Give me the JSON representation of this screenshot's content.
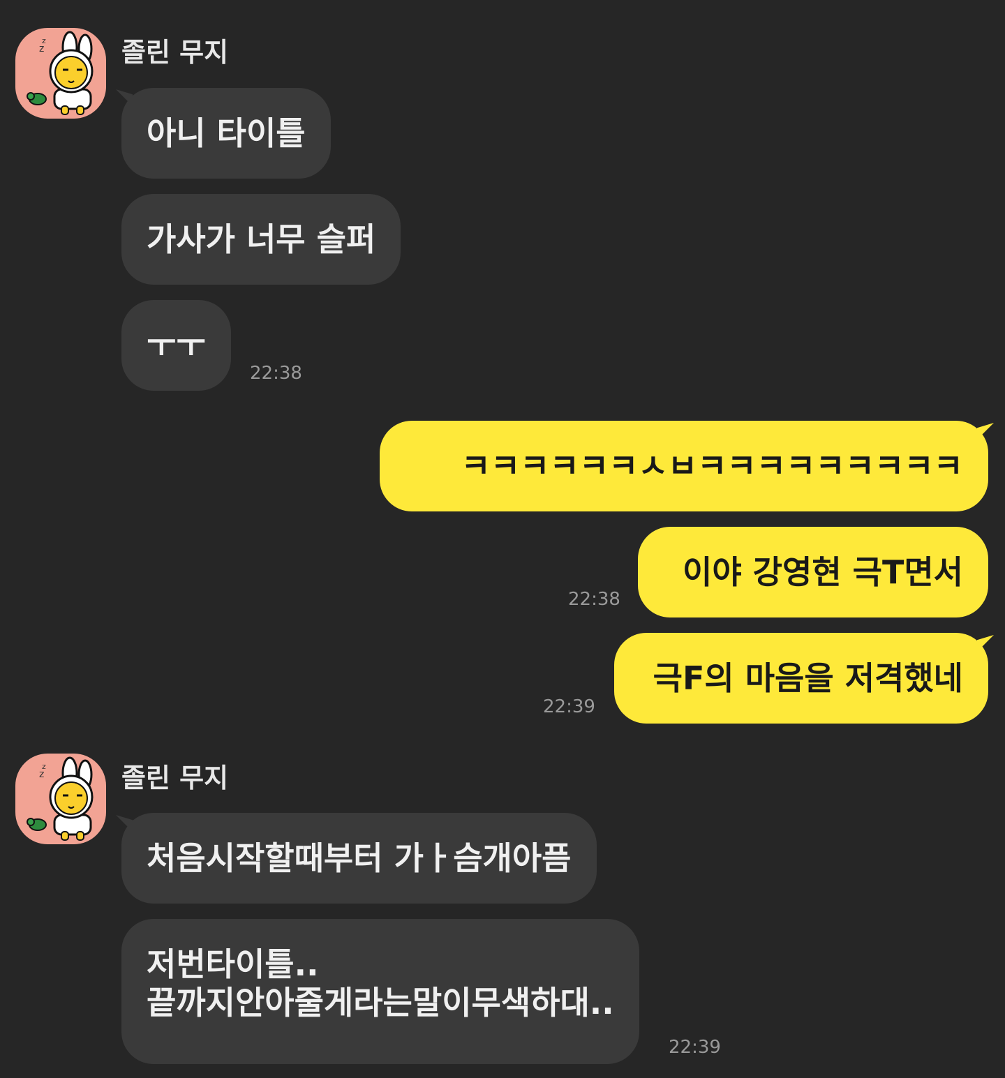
{
  "groups": [
    {
      "sender": "졸린 무지",
      "avatar_icon": "sleepy-muzi-avatar-icon",
      "messages": [
        "아니 타이틀",
        "가사가 너무 슬퍼",
        "ㅜㅜ"
      ],
      "time": "22:38"
    },
    {
      "sender": "졸린 무지",
      "avatar_icon": "sleepy-muzi-avatar-icon",
      "messages": [
        "처음시작할때부터 가ㅏ슴개아픔",
        "저번타이틀..\n끝까지안아줄게라는말이무색하대.."
      ],
      "time": "22:39"
    }
  ],
  "outgoing": [
    {
      "text": "ㅋㅋㅋㅋㅋㅋㅅㅂㅋㅋㅋㅋㅋㅋㅋㅋㅋ",
      "time": ""
    },
    {
      "text": "이야 강영현 극T면서",
      "time": "22:38"
    },
    {
      "text": "극F의 마음을 저격했네",
      "time": "22:39"
    }
  ],
  "colors": {
    "background": "#262626",
    "incoming_bubble": "#3a3a3a",
    "outgoing_bubble": "#fee93a",
    "avatar_bg": "#f2a394"
  }
}
